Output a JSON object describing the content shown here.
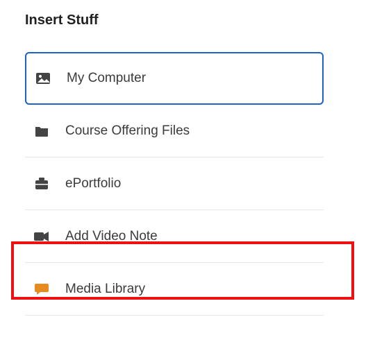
{
  "title": "Insert Stuff",
  "items": [
    {
      "label": "My Computer",
      "icon": "image-icon",
      "selected": true
    },
    {
      "label": "Course Offering Files",
      "icon": "folder-icon",
      "selected": false
    },
    {
      "label": "ePortfolio",
      "icon": "briefcase-icon",
      "selected": false
    },
    {
      "label": "Add Video Note",
      "icon": "video-icon",
      "selected": false
    },
    {
      "label": "Media Library",
      "icon": "chat-icon",
      "selected": false
    }
  ],
  "highlight_index": 3
}
